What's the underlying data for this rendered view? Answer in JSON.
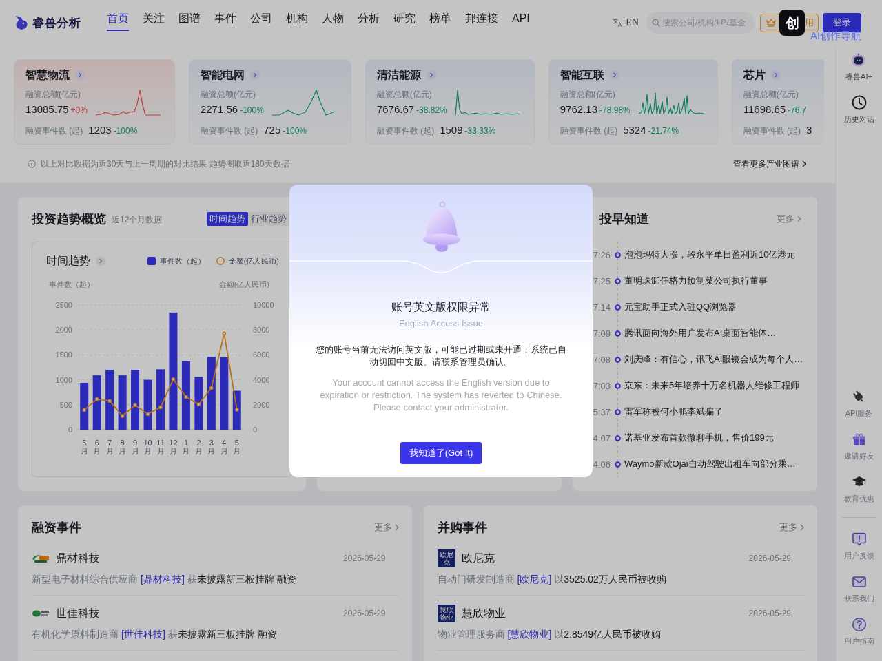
{
  "header": {
    "logo": "睿兽分析",
    "nav": [
      {
        "label": "首页",
        "selected": true
      },
      {
        "label": "关注",
        "selected": false
      },
      {
        "label": "图谱",
        "selected": false
      },
      {
        "label": "事件",
        "selected": false
      },
      {
        "label": "公司",
        "selected": false
      },
      {
        "label": "机构",
        "selected": false
      },
      {
        "label": "人物",
        "selected": false
      },
      {
        "label": "分析",
        "selected": false
      },
      {
        "label": "研究",
        "selected": false
      },
      {
        "label": "榜单",
        "selected": false
      },
      {
        "label": "邦连接",
        "selected": false
      },
      {
        "label": "API",
        "selected": false
      }
    ],
    "language": "EN",
    "search": {
      "placeholder": "搜索公司/机构/LP/基金"
    },
    "vip_button": "用",
    "login_button": "登录"
  },
  "floating_widget": {
    "badge": "创",
    "label": "AI创作导航"
  },
  "industry_cards": [
    {
      "title": "智慧物流",
      "amount_label": "融资总额(亿元)",
      "amount": "13085.75",
      "amount_change": "+0%",
      "amount_up": true,
      "count_label": "融资事件数 (起)",
      "count": "1203",
      "count_change": "-100%",
      "count_up": false
    },
    {
      "title": "智能电网",
      "amount_label": "融资总额(亿元)",
      "amount": "2271.56",
      "amount_change": "-100%",
      "amount_up": false,
      "count_label": "融资事件数 (起)",
      "count": "725",
      "count_change": "-100%",
      "count_up": false
    },
    {
      "title": "清洁能源",
      "amount_label": "融资总额(亿元)",
      "amount": "7676.67",
      "amount_change": "-38.82%",
      "amount_up": false,
      "count_label": "融资事件数 (起)",
      "count": "1509",
      "count_change": "-33.33%",
      "count_up": false
    },
    {
      "title": "智能互联",
      "amount_label": "融资总额(亿元)",
      "amount": "9762.13",
      "amount_change": "-78.98%",
      "amount_up": false,
      "count_label": "融资事件数 (起)",
      "count": "5324",
      "count_change": "-21.74%",
      "count_up": false
    },
    {
      "title": "芯片",
      "amount_label": "融资总额(亿元)",
      "amount": "11698.65",
      "amount_change": "-76.7",
      "amount_up": false,
      "count_label": "融资事件数 (起)",
      "count": "3"
    }
  ],
  "industry_note": "以上对比数据为近30天与上一周期的对比结果 趋势图取近180天数据",
  "industry_more": "查看更多产业图谱",
  "trend_panel": {
    "title": "投资趋势概览",
    "subtitle": "近12个月数据",
    "tabs": [
      {
        "label": "时间趋势",
        "selected": true
      },
      {
        "label": "行业趋势",
        "selected": false
      }
    ],
    "chart_data": {
      "type": "bar",
      "title": "时间趋势",
      "legend": "top-right",
      "grid": true,
      "ylabel": "事件数（起）",
      "y2label": "金额(亿人民币)",
      "categories": [
        "5月",
        "6月",
        "7月",
        "8月",
        "9月",
        "10月",
        "11月",
        "12月",
        "1月",
        "2月",
        "3月",
        "4月",
        "5月"
      ],
      "ylim": [
        0,
        2500
      ],
      "yticks": [
        0,
        500,
        1000,
        1500,
        2000,
        2500
      ],
      "y2lim": [
        0,
        10000
      ],
      "y2ticks": [
        0,
        2000,
        4000,
        6000,
        8000,
        10000
      ],
      "series": [
        {
          "name": "事件数（起）",
          "color": "#3a37f0",
          "values": [
            940,
            1090,
            1200,
            1090,
            1200,
            1000,
            1210,
            2350,
            1370,
            1060,
            1460,
            1450,
            780
          ]
        },
        {
          "name": "金额(亿人民币)",
          "color": "#f0932b",
          "type": "line",
          "axis": "y2",
          "marker": "circle",
          "values": [
            1580,
            2450,
            2300,
            1100,
            1970,
            1250,
            1800,
            4050,
            2630,
            2030,
            3350,
            7720,
            1600
          ]
        }
      ]
    }
  },
  "news_panel": {
    "title": "投早知道",
    "more": "更多",
    "items": [
      {
        "time": "7:26",
        "title": "泡泡玛特大涨，段永平单日盈利近10亿港元"
      },
      {
        "time": "7:25",
        "title": "董明珠卸任格力预制菜公司执行董事"
      },
      {
        "time": "7:14",
        "title": "元宝助手正式入驻QQ浏览器"
      },
      {
        "time": "7:09",
        "title": "腾讯面向海外用户发布AI桌面智能体…"
      },
      {
        "time": "7:08",
        "title": "刘庆峰：有信心，讯飞AI眼镜会成为每个人…"
      },
      {
        "time": "7:03",
        "title": "京东：未来5年培养十万名机器人维修工程师"
      },
      {
        "time": "5:37",
        "title": "雷军称被何小鹏李斌骗了"
      },
      {
        "time": "4:07",
        "title": "诺基亚发布首款微聊手机，售价199元"
      },
      {
        "time": "4:06",
        "title": "Waymo新款Ojai自动驾驶出租车向部分乘…"
      }
    ]
  },
  "funding_events": {
    "title": "融资事件",
    "more": "更多",
    "items": [
      {
        "name": "鼎材科技",
        "date": "2026-05-29",
        "logo": {
          "kind": "image"
        },
        "description": {
          "prefix": "新型电子材料综合供应商",
          "company": "[鼎材科技]",
          "verb": "获",
          "detail": "未披露新三板挂牌 融资"
        }
      },
      {
        "name": "世佳科技",
        "date": "2026-05-29",
        "logo": {
          "kind": "image"
        },
        "description": {
          "prefix": "有机化学原料制造商",
          "company": "[世佳科技]",
          "verb": "获",
          "detail": "未披露新三板挂牌 融资"
        }
      }
    ]
  },
  "merger_events": {
    "title": "并购事件",
    "more": "更多",
    "items": [
      {
        "name": "欧尼克",
        "date": "2026-05-29",
        "logo": {
          "kind": "text",
          "text": "欧尼克"
        },
        "description": {
          "prefix": "自动门研发制造商",
          "company": "[欧尼克]",
          "verb": "以",
          "detail": "3525.02万人民币被收购"
        }
      },
      {
        "name": "慧欣物业",
        "date": "2026-05-29",
        "logo": {
          "kind": "text",
          "text": "慧欣物业"
        },
        "description": {
          "prefix": "物业管理服务商",
          "company": "[慧欣物业]",
          "verb": "以",
          "detail": "2.8549亿人民币被收购"
        }
      }
    ]
  },
  "sidebar": {
    "top": [
      {
        "label": "睿兽AI+"
      },
      {
        "label": "历史对话"
      }
    ],
    "services": [
      {
        "label": "API服务"
      },
      {
        "label": "邀请好友"
      },
      {
        "label": "教育优惠"
      }
    ],
    "support": [
      {
        "label": "用户反馈"
      },
      {
        "label": "联系我们"
      },
      {
        "label": "用户指南"
      }
    ]
  },
  "modal": {
    "title": "账号英文版权限异常",
    "subtitle": "English Access Issue",
    "message": "您的账号当前无法访问英文版，可能已过期或未开通，系统已自动切回中文版。请联系管理员确认。",
    "message_en": "Your account cannot access the English version due to expiration or restriction. The system has reverted to Chinese. Please contact your administrator.",
    "button": "我知道了(Got It)"
  }
}
